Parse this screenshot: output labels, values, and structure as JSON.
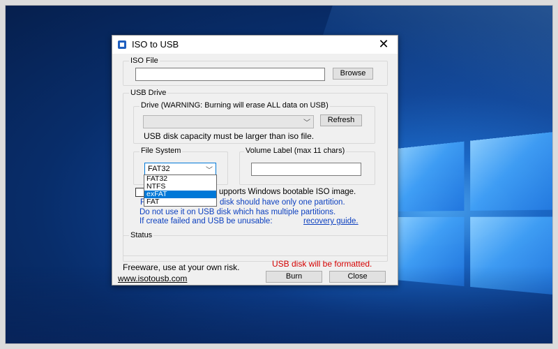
{
  "window": {
    "title": "ISO to USB",
    "close_glyph": "✕"
  },
  "iso_file": {
    "legend": "ISO File",
    "path_value": "",
    "browse_label": "Browse"
  },
  "usb_drive": {
    "legend": "USB Drive",
    "drive_legend": "Drive (WARNING: Burning will erase ALL data on USB)",
    "drive_value": "",
    "refresh_label": "Refresh",
    "capacity_note": "USB disk capacity must be larger than iso file."
  },
  "file_system": {
    "legend": "File System",
    "selected": "FAT32",
    "options": [
      "FAT32",
      "NTFS",
      "exFAT",
      "FAT"
    ],
    "highlighted_index": 2
  },
  "volume_label": {
    "legend": "Volume Label (max 11 chars)",
    "value": ""
  },
  "bootable": {
    "label_tail": "upports Windows bootable ISO image.",
    "note1_prefix": "F",
    "note1_tail": "disk should have only one partition.",
    "note2": "Do not use it on USB disk which has multiple partitions.",
    "note3_prefix": "If create failed and USB be unusable:",
    "recovery_link": "recovery guide."
  },
  "status": {
    "legend": "Status",
    "value": ""
  },
  "footer": {
    "freeware": "Freeware, use at your own risk.",
    "warning": "USB disk will be formatted.",
    "website": "www.isotousb.com",
    "burn_label": "Burn",
    "close_label": "Close"
  },
  "colors": {
    "accent": "#0078d7",
    "link": "#0b3fbf",
    "warning": "#d40000"
  }
}
